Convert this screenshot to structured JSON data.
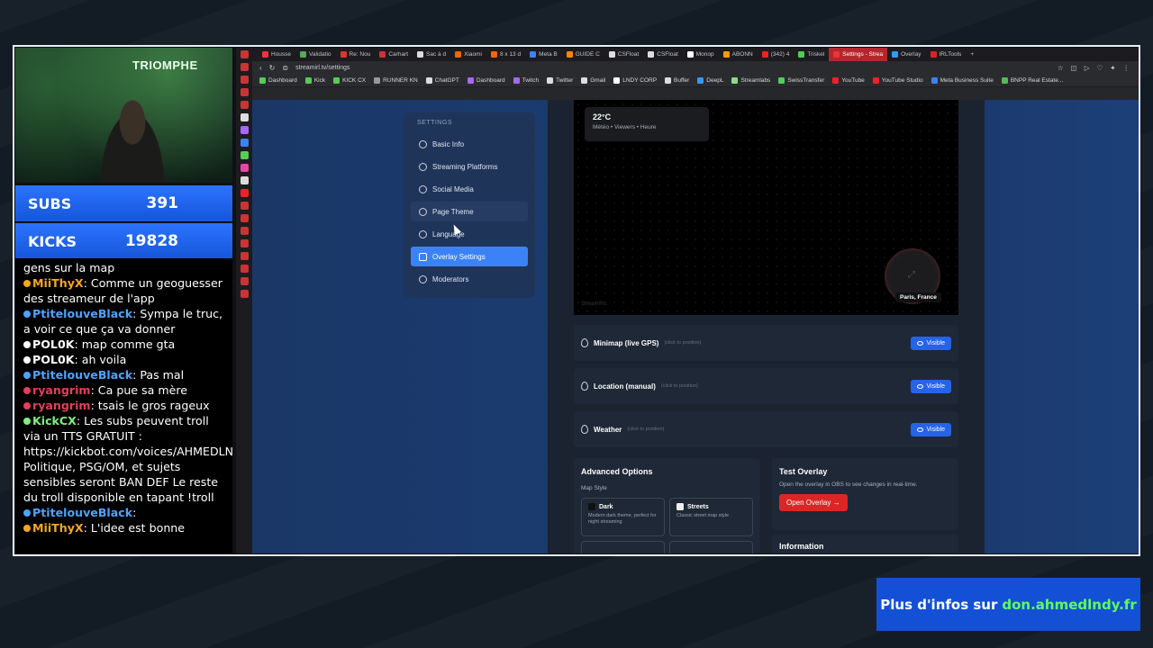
{
  "stream": {
    "subs_label": "SUBS",
    "subs_value": "391",
    "kicks_label": "KICKS",
    "kicks_value": "19828",
    "cam_text": "TRIOMPHE",
    "banner_prefix": "Plus d'infos sur",
    "banner_link": "don.ahmedlndy.fr"
  },
  "chat": [
    {
      "user": "",
      "user_color": "#fff",
      "text": "gens sur la map"
    },
    {
      "user": "MiiThyX",
      "user_color": "#f5a623",
      "text": ": Comme un geoguesser des streameur de l'app"
    },
    {
      "user": "PtitelouveBlack",
      "user_color": "#4da3ff",
      "text": ": Sympa le truc, a voir ce que ça va donner"
    },
    {
      "user": "POL0K",
      "user_color": "#ffffff",
      "text": ": map comme gta"
    },
    {
      "user": "POL0K",
      "user_color": "#ffffff",
      "text": ": ah voila"
    },
    {
      "user": "PtitelouveBlack",
      "user_color": "#4da3ff",
      "text": ": Pas mal"
    },
    {
      "user": "ryangrim",
      "user_color": "#e0405a",
      "text": ": Ca pue sa mère"
    },
    {
      "user": "ryangrim",
      "user_color": "#e0405a",
      "text": ": tsais le gros rageux"
    },
    {
      "user": "KickCX",
      "user_color": "#7df07d",
      "text": ": Les subs peuvent troll via un TTS GRATUIT : https://kickbot.com/voices/AHMEDLNDY Politique, PSG/OM, et sujets sensibles seront BAN DEF Le reste du troll disponible en tapant !troll"
    },
    {
      "user": "PtitelouveBlack",
      "user_color": "#4da3ff",
      "text": ":"
    },
    {
      "user": "MiiThyX",
      "user_color": "#f5a623",
      "text": ": L'idee est bonne"
    }
  ],
  "browser": {
    "tabs": [
      "Housse",
      "Validatio",
      "Re: Nou",
      "Carhart",
      "Sac à d",
      "Xiaomi",
      "8 x 13 d",
      "Meta B",
      "GUIDE C",
      "CSFloat",
      "CSFloat",
      "Monop",
      "ABONN",
      "(342) 4",
      "Triskel",
      "Settings - Strea",
      "Overlay",
      "IRLTools"
    ],
    "tab_colors": [
      "#e34",
      "#5a5",
      "#d33",
      "#c33",
      "#ddd",
      "#e60",
      "#f60",
      "#3b82f6",
      "#f80",
      "#ddd",
      "#ddd",
      "#fff",
      "#f90",
      "#e22",
      "#5c5",
      "#e33",
      "#39f",
      "#d22"
    ],
    "active_tab_index": 15,
    "url": "streamirl.tv/settings",
    "bookmarks": [
      "Dashboard",
      "Kick",
      "KICK CX",
      "RUNNER KN",
      "ChatGPT",
      "Dashboard",
      "Twitch",
      "Twitter",
      "Gmail",
      "LNDY CORP",
      "Buffer",
      "DeepL",
      "Streamlabs",
      "SwissTransfer",
      "YouTube",
      "YouTube Studio",
      "Meta Business Suite",
      "BNPP Real Estate..."
    ],
    "bookmark_colors": [
      "#5c5",
      "#5c5",
      "#5c5",
      "#999",
      "#ddd",
      "#a6f",
      "#a6f",
      "#ddd",
      "#ddd",
      "#fff",
      "#ddd",
      "#39f",
      "#8d8",
      "#5c5",
      "#e22",
      "#e22",
      "#3b82f6",
      "#5b5"
    ]
  },
  "settings": {
    "title": "SETTINGS",
    "items": [
      "Basic Info",
      "Streaming Platforms",
      "Social Media",
      "Page Theme",
      "Language",
      "Overlay Settings",
      "Moderators"
    ],
    "active_index": 5,
    "hover_index": 3
  },
  "preview": {
    "temp": "22°C",
    "weather_sub": "Météo • Viewers • Heure",
    "city": "Paris, France",
    "watermark": "StreamIRL"
  },
  "rows": [
    {
      "name": "Minimap (live GPS)",
      "hint": "(click to position)",
      "button": "Visible"
    },
    {
      "name": "Location (manual)",
      "hint": "(click to position)",
      "button": "Visible"
    },
    {
      "name": "Weather",
      "hint": "(click to position)",
      "button": "Visible"
    }
  ],
  "advanced": {
    "title": "Advanced Options",
    "map_style_label": "Map Style",
    "dark_name": "Dark",
    "dark_desc": "Modern dark theme, perfect for night streaming",
    "streets_name": "Streets",
    "streets_desc": "Classic street map style"
  },
  "test": {
    "title": "Test Overlay",
    "desc": "Open the overlay in OBS to see changes in real-time.",
    "button": "Open Overlay →"
  },
  "info": {
    "title": "Information"
  },
  "colors": {
    "accent": "#3b82f6",
    "danger": "#dc2626",
    "stream_blue": "#1655d8",
    "link_green": "#5dff5d"
  }
}
